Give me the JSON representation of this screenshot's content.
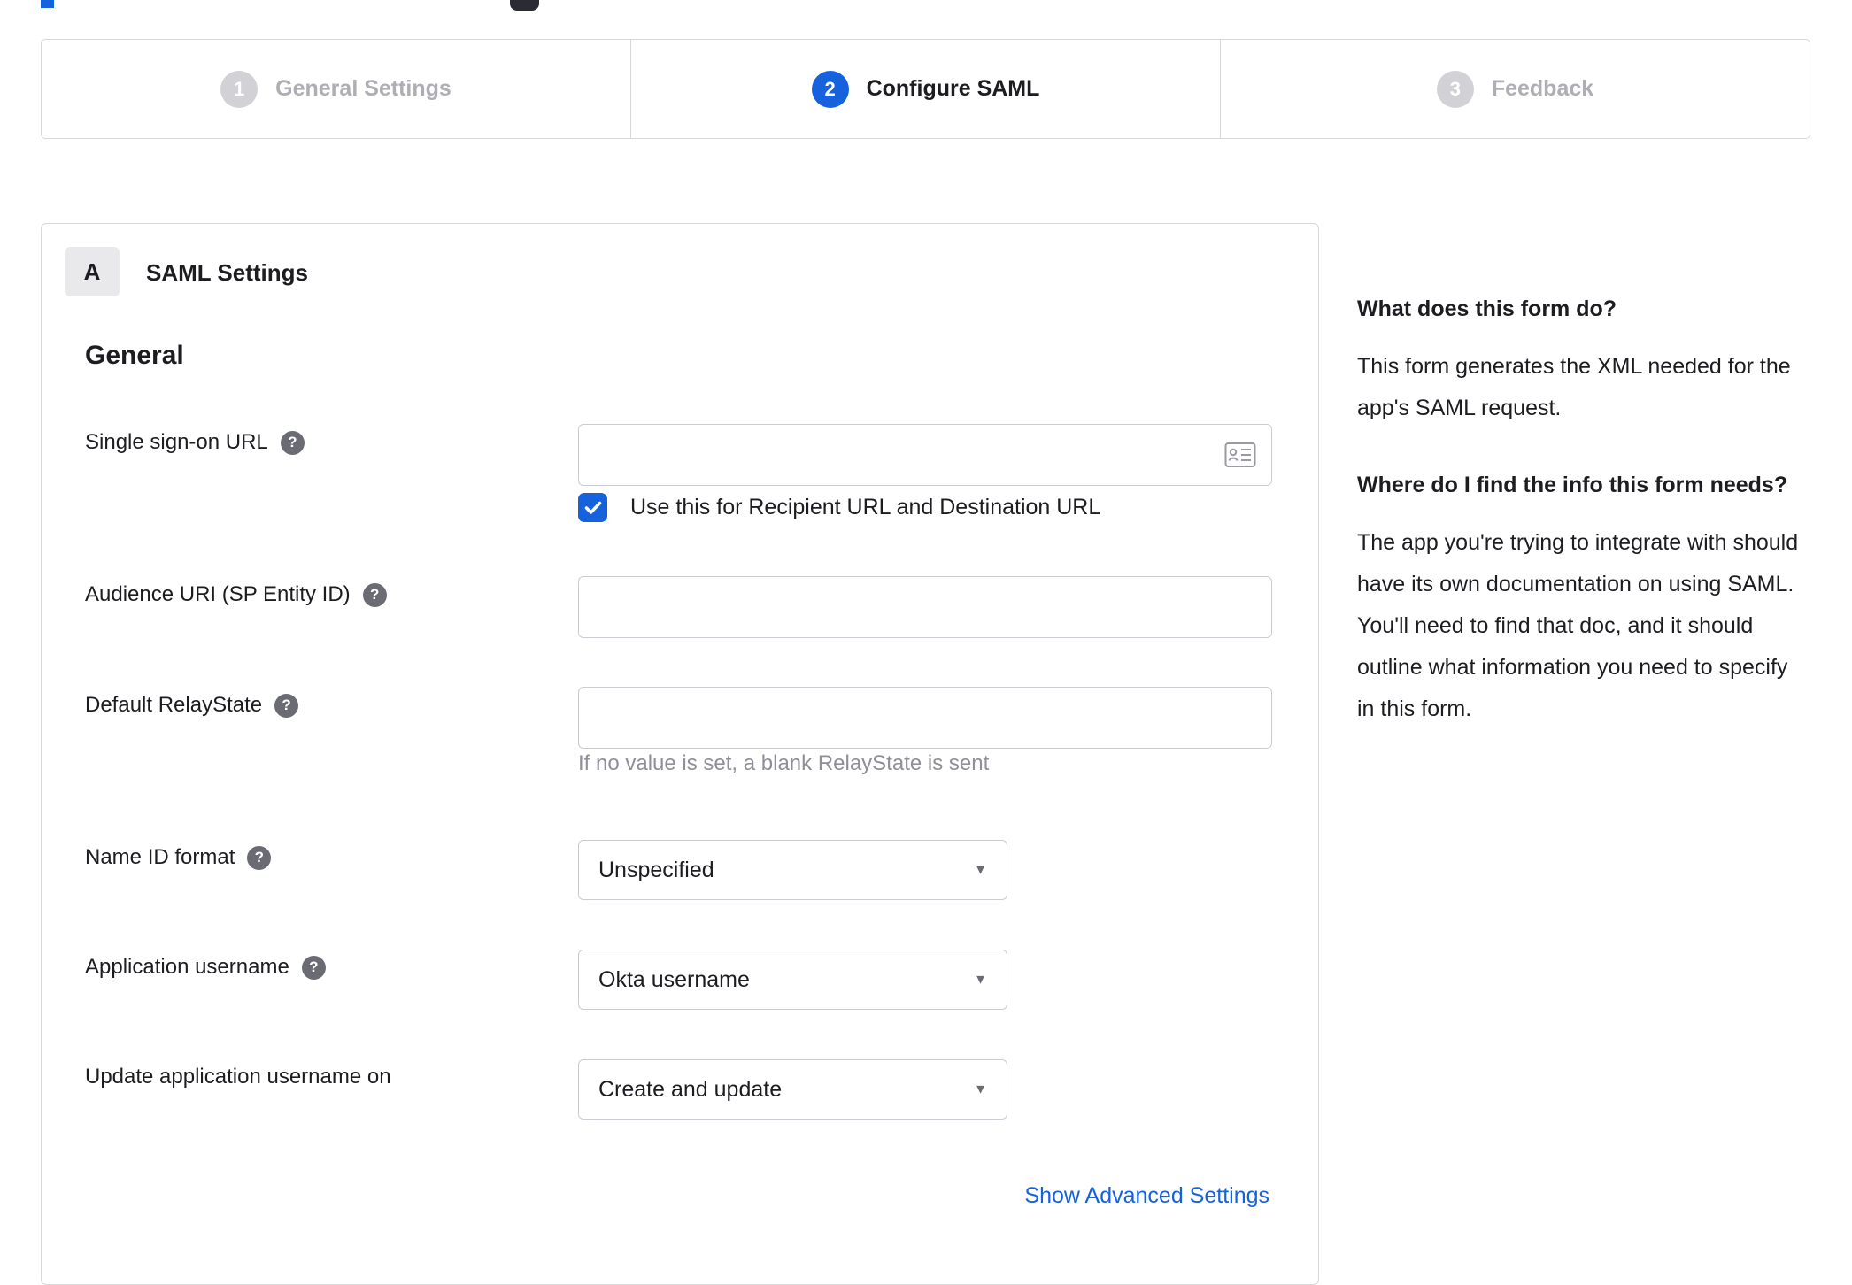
{
  "header": {
    "steps": [
      {
        "number": "1",
        "label": "General Settings"
      },
      {
        "number": "2",
        "label": "Configure SAML"
      },
      {
        "number": "3",
        "label": "Feedback"
      }
    ]
  },
  "form": {
    "badge": "A",
    "title": "SAML Settings",
    "group": "General",
    "help_glyph": "?",
    "sso": {
      "label": "Single sign-on URL",
      "value": ""
    },
    "sso_checkbox": {
      "label": "Use this for Recipient URL and Destination URL",
      "checked": true
    },
    "audience": {
      "label": "Audience URI (SP Entity ID)",
      "value": ""
    },
    "relay": {
      "label": "Default RelayState",
      "value": "",
      "hint": "If no value is set, a blank RelayState is sent"
    },
    "name_id": {
      "label": "Name ID format",
      "value": "Unspecified"
    },
    "app_user": {
      "label": "Application username",
      "value": "Okta username"
    },
    "update_user": {
      "label": "Update application username on",
      "value": "Create and update"
    },
    "advanced_link": "Show Advanced Settings"
  },
  "help_panel": {
    "q1": {
      "title": "What does this form do?",
      "body": "This form generates the XML needed for the app's SAML request."
    },
    "q2": {
      "title": "Where do I find the info this form needs?",
      "body": "The app you're trying to integrate with should have its own documentation on using SAML. You'll need to find that doc, and it should outline what information you need to specify in this form."
    }
  },
  "colors": {
    "accent": "#1662dd",
    "link": "#1662dd",
    "inactive_circle": "#d2d2d6",
    "inactive_label": "#aeaeb4",
    "text": "#1d1d21",
    "muted": "#8f8f98",
    "border": "#d8d8dc"
  }
}
